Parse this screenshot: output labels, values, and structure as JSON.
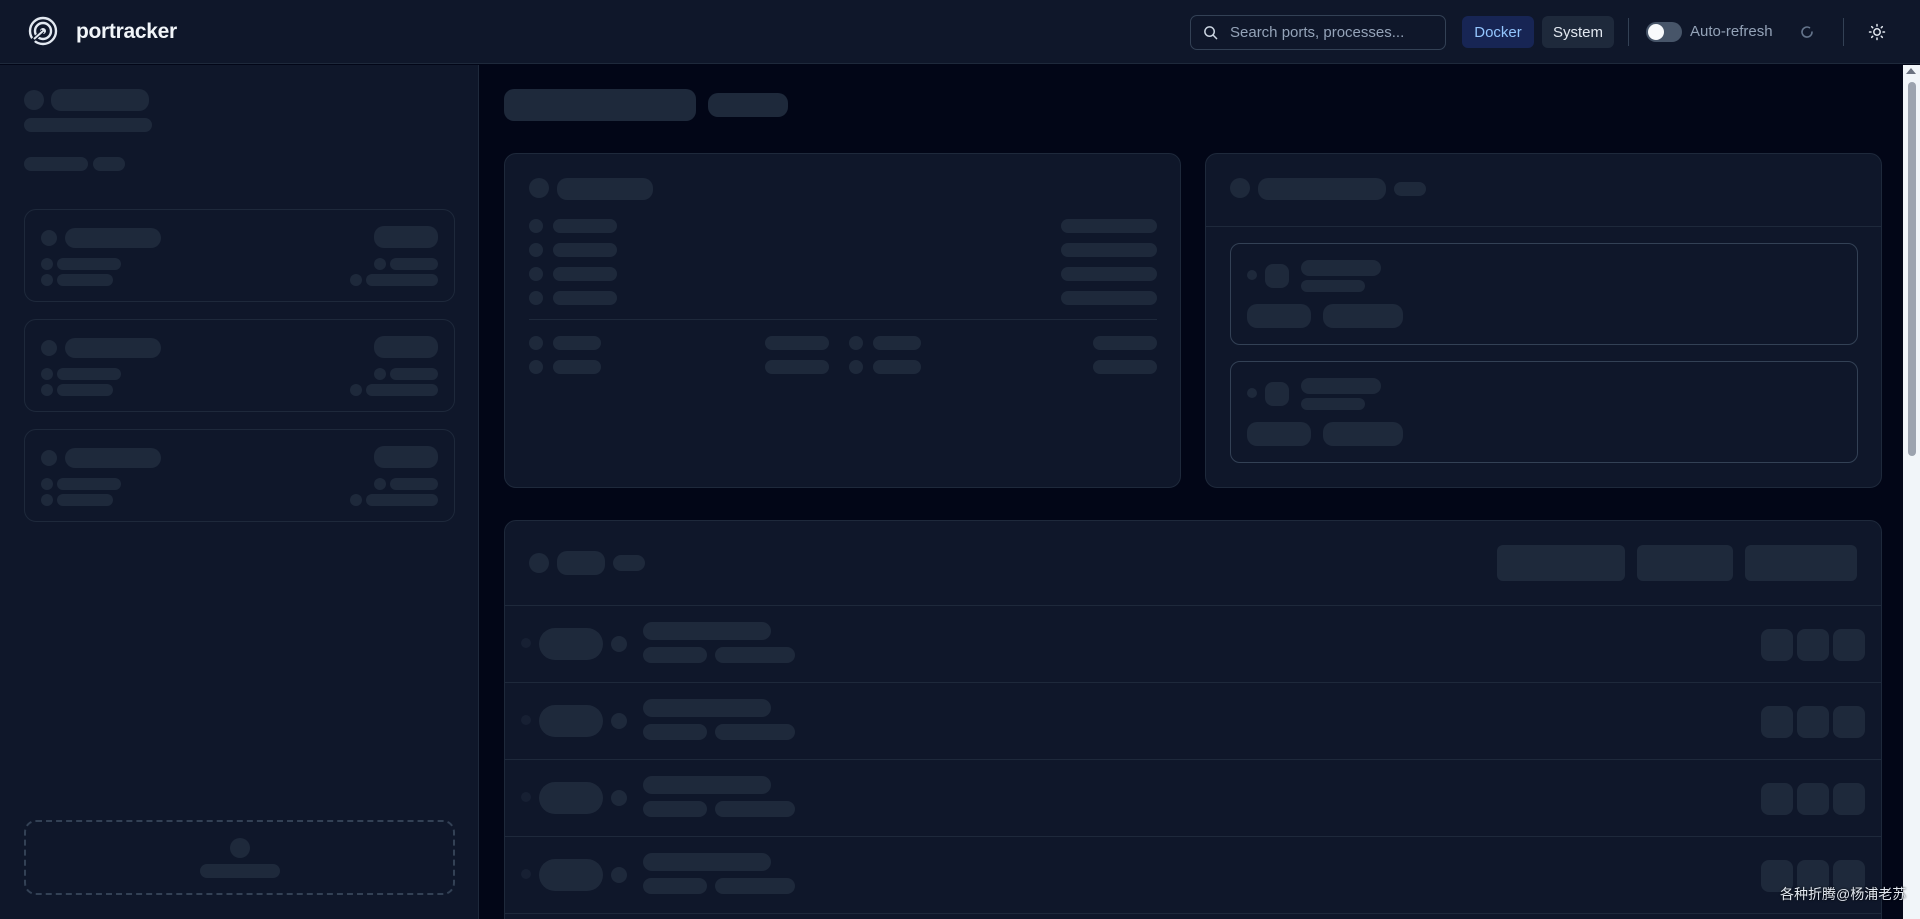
{
  "app": {
    "brand": "portracker",
    "accent": "#93c5fd",
    "background": "#020617",
    "surface": "#0f172a"
  },
  "header": {
    "search": {
      "placeholder": "Search ports, processes..."
    },
    "docker_label": "Docker",
    "system_label": "System",
    "auto_refresh_label": "Auto-refresh",
    "auto_refresh_enabled": false
  },
  "icons": {
    "logo": "portracker-logo-icon",
    "search": "search-icon",
    "refresh": "refresh-icon",
    "theme": "sun-icon"
  },
  "overlay": {
    "watermark": "各种折腾@杨浦老苏"
  }
}
